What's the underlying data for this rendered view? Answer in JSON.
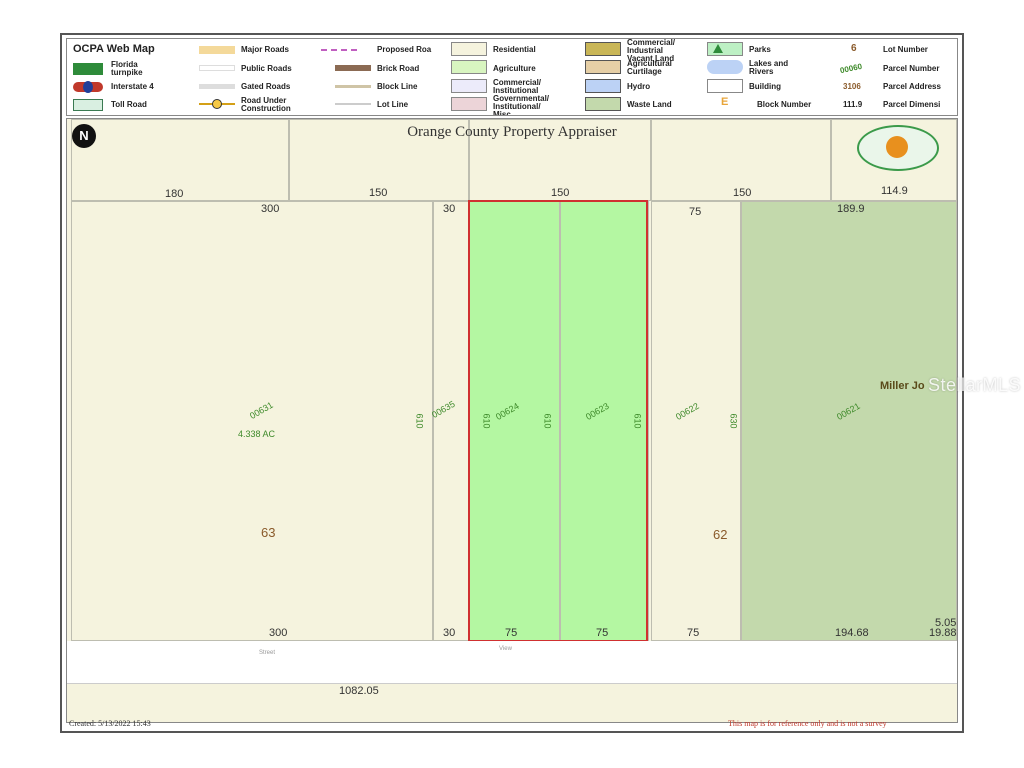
{
  "legend": {
    "title": "OCPA Web Map",
    "items": {
      "florida_turnpike": "Florida turnpike",
      "interstate4": "Interstate 4",
      "toll_road": "Toll Road",
      "major_roads": "Major Roads",
      "public_roads": "Public Roads",
      "gated_roads": "Gated Roads",
      "road_under_construction": "Road Under Construction",
      "proposed_road": "Proposed Roa",
      "brick_road": "Brick Road",
      "block_line": "Block Line",
      "lot_line": "Lot Line",
      "residential": "Residential",
      "agriculture": "Agriculture",
      "commercial_institutional": "Commercial/ Institutional",
      "governmental": "Governmental/ Institutional/ Misc",
      "commercial_industrial": "Commercial/ Industrial Vacant Land",
      "agricultural_curtilage": "Agricultural Curtilage",
      "hydro": "Hydro",
      "waste_land": "Waste Land",
      "parks": "Parks",
      "lakes_rivers": "Lakes and Rivers",
      "building": "Building",
      "block_number": "Block Number",
      "lot_number": "Lot Number",
      "parcel_number": "Parcel Number",
      "parcel_address": "Parcel Address",
      "parcel_dimension": "Parcel Dimensi"
    },
    "samples": {
      "lot_number": "6",
      "parcel_number": "00060",
      "parcel_address": "3106",
      "parcel_dimension": "111.9",
      "block_letter": "E"
    }
  },
  "map": {
    "title": "Orange County Property Appraiser",
    "north_symbol": "N",
    "top_dims": [
      "180",
      "150",
      "150",
      "150",
      "114.9"
    ],
    "dims": {
      "d300_top": "300",
      "d30_top": "30",
      "d75_top": "75",
      "d189": "189.9",
      "d300_bot": "300",
      "d30_bot": "30",
      "d75_bot_a": "75",
      "d75_bot_b": "75",
      "d75_bot_c": "75",
      "d194": "194.68",
      "d505": "5.05",
      "d198": "19.88",
      "d1082": "1082.05"
    },
    "parcels": {
      "p00631": "00631",
      "p00635": "00635",
      "p00624": "00624",
      "p00623": "00623",
      "p00622": "00622",
      "p00621": "00621"
    },
    "addresses": [
      "610",
      "610",
      "610",
      "610",
      "630"
    ],
    "acreage": "4.338 AC",
    "blocks": {
      "b63": "63",
      "b62": "62"
    },
    "owner_label": "Miller Jo",
    "street_labels": [
      "Street",
      "View"
    ]
  },
  "footer": {
    "created": "Created: 5/13/2022 15:43",
    "disclaimer": "This map is for reference only and is not a survey"
  },
  "watermark": "StellarMLS",
  "colors": {
    "residential": "#f5f3de",
    "agriculture": "#b4f7a2",
    "waste_land": "#c3d9ac",
    "selected_outline": "#d03030"
  }
}
